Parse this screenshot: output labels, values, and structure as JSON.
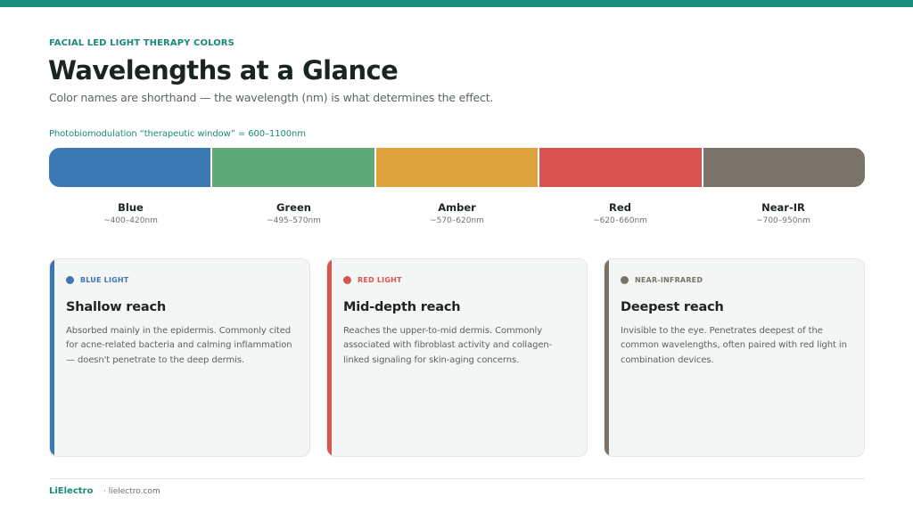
{
  "header": {
    "eyebrow": "FACIAL LED LIGHT THERAPY COLORS",
    "title": "Wavelengths at a Glance",
    "subtitle": "Color names are shorthand — the wavelength (nm) is what determines the effect."
  },
  "spectrum": {
    "window_label": "Photobiomodulation “therapeutic window” = 600–1100nm",
    "bands": [
      {
        "name": "Blue",
        "range": "~400–420nm",
        "color": "#3c78b4"
      },
      {
        "name": "Green",
        "range": "~495–570nm",
        "color": "#5fa878"
      },
      {
        "name": "Amber",
        "range": "~570–620nm",
        "color": "#dea33c"
      },
      {
        "name": "Red",
        "range": "~620–660nm",
        "color": "#d95450"
      },
      {
        "name": "Near-IR",
        "range": "~700–950nm",
        "color": "#7a736a"
      }
    ]
  },
  "cards": [
    {
      "tag": "BLUE LIGHT",
      "accent": "#3c78b4",
      "heading": "Shallow reach",
      "body": "Absorbed mainly in the epidermis. Commonly cited for acne-related bacteria and calming inflammation — doesn't penetrate to the deep dermis."
    },
    {
      "tag": "RED LIGHT",
      "accent": "#d95450",
      "heading": "Mid-depth reach",
      "body": "Reaches the upper-to-mid dermis. Commonly associated with fibroblast activity and collagen-linked signaling for skin-aging concerns."
    },
    {
      "tag": "NEAR-INFRARED",
      "accent": "#7a736a",
      "heading": "Deepest reach",
      "body": "Invisible to the eye. Penetrates deepest of the common wavelengths, often paired with red light in combination devices."
    }
  ],
  "footer": {
    "brand": "LiElectro",
    "site": "· lielectro.com"
  }
}
